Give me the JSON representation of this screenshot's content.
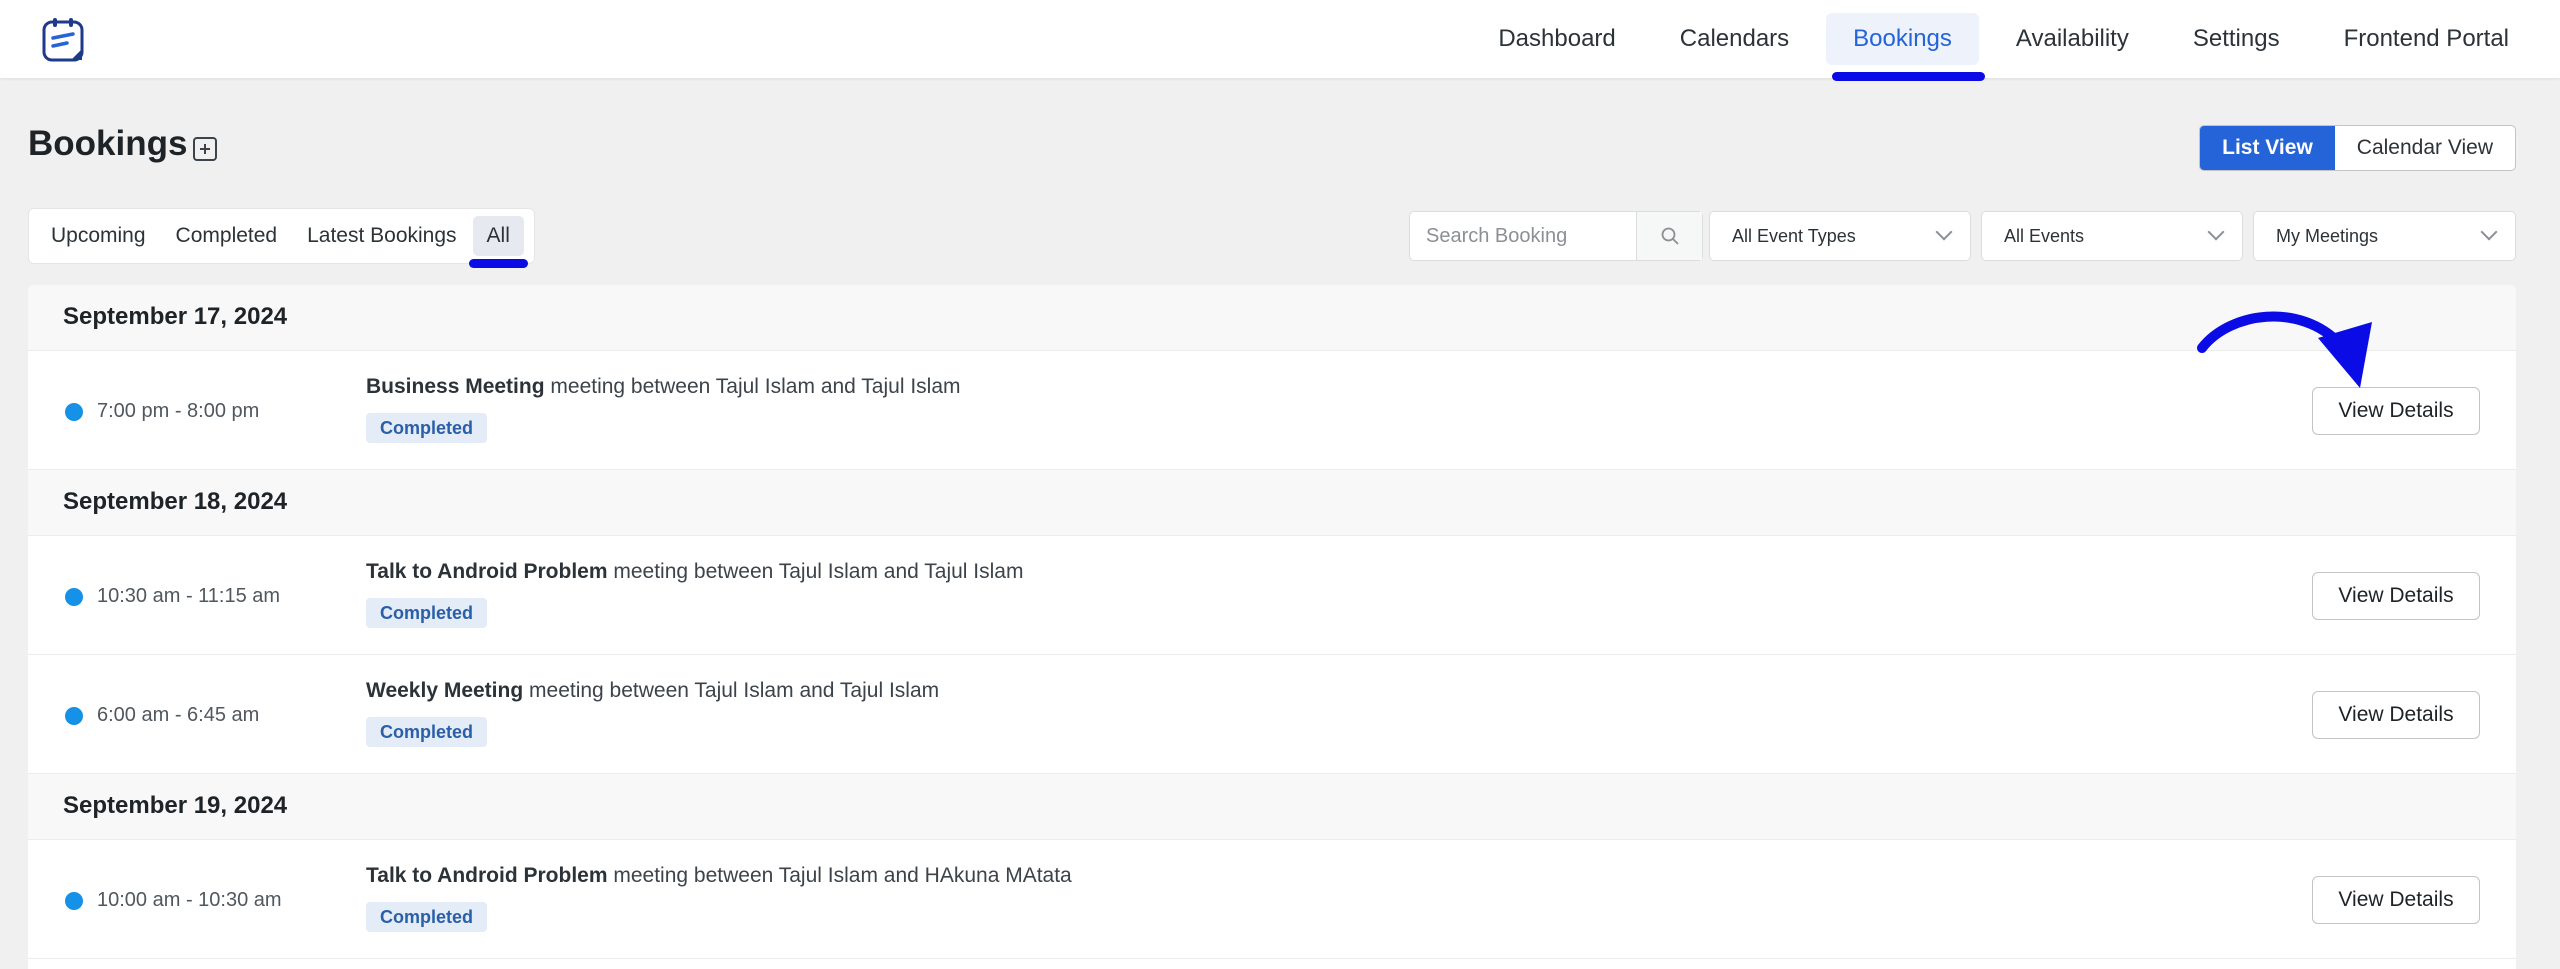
{
  "nav": {
    "items": [
      {
        "label": "Dashboard"
      },
      {
        "label": "Calendars"
      },
      {
        "label": "Bookings"
      },
      {
        "label": "Availability"
      },
      {
        "label": "Settings"
      },
      {
        "label": "Frontend Portal"
      }
    ],
    "active": "Bookings"
  },
  "header": {
    "title": "Bookings",
    "add_icon": "plus-square-icon",
    "views": {
      "list": "List View",
      "calendar": "Calendar View",
      "active": "List View"
    }
  },
  "filters": {
    "tabs": [
      {
        "label": "Upcoming"
      },
      {
        "label": "Completed"
      },
      {
        "label": "Latest Bookings"
      },
      {
        "label": "All"
      }
    ],
    "active_tab": "All",
    "search": {
      "placeholder": "Search Booking",
      "value": "",
      "icon": "search-icon"
    },
    "event_types": "All Event Types",
    "events": "All Events",
    "meetings": "My Meetings"
  },
  "groups": [
    {
      "date": "September 17, 2024",
      "bookings": [
        {
          "time": "7:00 pm - 8:00 pm",
          "event": "Business Meeting",
          "desc": "meeting between Tajul Islam and Tajul Islam",
          "status": "Completed",
          "action": "View Details"
        }
      ]
    },
    {
      "date": "September 18, 2024",
      "bookings": [
        {
          "time": "10:30 am - 11:15 am",
          "event": "Talk to Android Problem",
          "desc": "meeting between Tajul Islam and Tajul Islam",
          "status": "Completed",
          "action": "View Details"
        },
        {
          "time": "6:00 am - 6:45 am",
          "event": "Weekly Meeting",
          "desc": "meeting between Tajul Islam and Tajul Islam",
          "status": "Completed",
          "action": "View Details"
        }
      ]
    },
    {
      "date": "September 19, 2024",
      "bookings": [
        {
          "time": "10:00 am - 10:30 am",
          "event": "Talk to Android Problem",
          "desc": "meeting between Tajul Islam and HAkuna MAtata",
          "status": "Completed",
          "action": "View Details"
        }
      ]
    }
  ],
  "colors": {
    "accent": "#2563d8",
    "annotation": "#0b0be6",
    "status_dot": "#1591e8",
    "badge_bg": "#e4ecf7",
    "badge_text": "#2a5fa8"
  }
}
